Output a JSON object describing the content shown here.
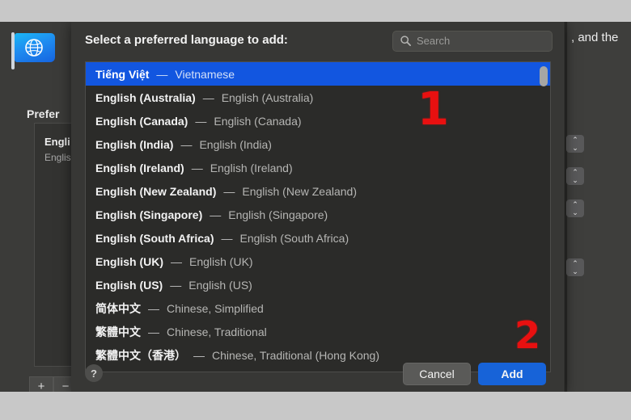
{
  "background": {
    "flag_icon": "globe-flag-icon",
    "preferred_label": "Prefer",
    "list_item_primary": "Engli",
    "list_item_secondary": "Englis",
    "add_button_label": "+",
    "remove_button_label": "−",
    "right_text": ", and the",
    "chevron_glyph": "⌃⌄"
  },
  "dialog": {
    "title": "Select a preferred language to add:",
    "search": {
      "placeholder": "Search",
      "value": "",
      "icon": "search-icon"
    },
    "help_label": "?",
    "cancel_label": "Cancel",
    "add_label": "Add",
    "selected_index": 0,
    "languages": [
      {
        "native": "Tiếng Việt",
        "english": "Vietnamese"
      },
      {
        "native": "English (Australia)",
        "english": "English (Australia)"
      },
      {
        "native": "English (Canada)",
        "english": "English (Canada)"
      },
      {
        "native": "English (India)",
        "english": "English (India)"
      },
      {
        "native": "English (Ireland)",
        "english": "English (Ireland)"
      },
      {
        "native": "English (New Zealand)",
        "english": "English (New Zealand)"
      },
      {
        "native": "English (Singapore)",
        "english": "English (Singapore)"
      },
      {
        "native": "English (South Africa)",
        "english": "English (South Africa)"
      },
      {
        "native": "English (UK)",
        "english": "English (UK)"
      },
      {
        "native": "English (US)",
        "english": "English (US)"
      },
      {
        "native": "简体中文",
        "english": "Chinese, Simplified"
      },
      {
        "native": "繁體中文",
        "english": "Chinese, Traditional"
      },
      {
        "native": "繁體中文（香港）",
        "english": "Chinese, Traditional (Hong Kong)"
      }
    ],
    "dash": "—"
  },
  "annotations": {
    "one": "1",
    "two": "2",
    "color": "#e81010"
  },
  "colors": {
    "accent_blue": "#1763d8",
    "selection_blue": "#1256e0",
    "dialog_bg": "#373735",
    "list_bg": "#2b2b29"
  }
}
